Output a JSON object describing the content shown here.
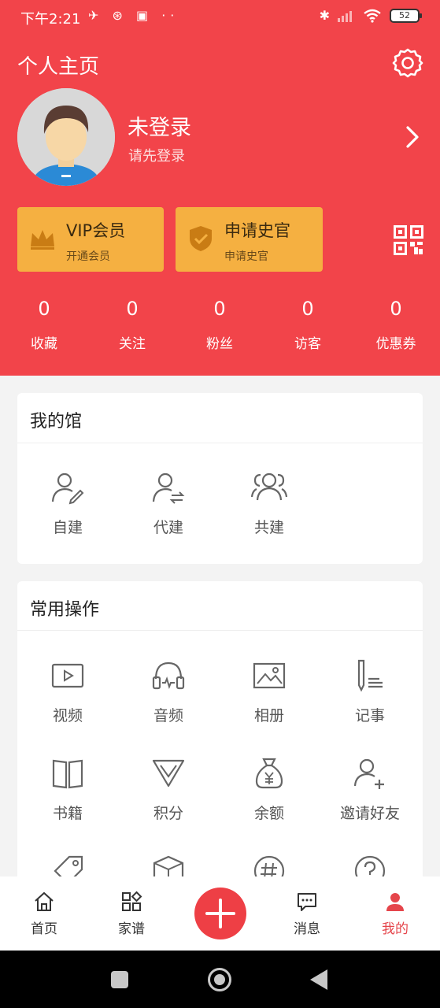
{
  "status_bar": {
    "time": "下午2:21",
    "left_icons": "✈ ⊛ ▣ ··",
    "battery": "52"
  },
  "header": {
    "title": "个人主页"
  },
  "profile": {
    "name": "未登录",
    "subtitle": "请先登录"
  },
  "cards": [
    {
      "title": "VIP会员",
      "subtitle": "开通会员"
    },
    {
      "title": "申请史官",
      "subtitle": "申请史官"
    }
  ],
  "stats": [
    {
      "value": "0",
      "label": "收藏"
    },
    {
      "value": "0",
      "label": "关注"
    },
    {
      "value": "0",
      "label": "粉丝"
    },
    {
      "value": "0",
      "label": "访客"
    },
    {
      "value": "0",
      "label": "优惠券"
    }
  ],
  "my_hall": {
    "title": "我的馆",
    "items": [
      {
        "label": "自建",
        "icon": "user-edit-icon"
      },
      {
        "label": "代建",
        "icon": "user-swap-icon"
      },
      {
        "label": "共建",
        "icon": "group-icon"
      }
    ]
  },
  "common_ops": {
    "title": "常用操作",
    "items": [
      {
        "label": "视频",
        "icon": "video-icon"
      },
      {
        "label": "音频",
        "icon": "headphones-icon"
      },
      {
        "label": "相册",
        "icon": "image-icon"
      },
      {
        "label": "记事",
        "icon": "notes-icon"
      },
      {
        "label": "书籍",
        "icon": "book-icon"
      },
      {
        "label": "积分",
        "icon": "diamond-icon"
      },
      {
        "label": "余额",
        "icon": "money-bag-icon"
      },
      {
        "label": "邀请好友",
        "icon": "add-user-icon"
      }
    ]
  },
  "bottom_nav": {
    "items": [
      {
        "label": "首页",
        "icon": "home-icon"
      },
      {
        "label": "家谱",
        "icon": "apps-icon"
      },
      {
        "label": "消息",
        "icon": "message-icon"
      },
      {
        "label": "我的",
        "icon": "profile-icon"
      }
    ]
  },
  "colors": {
    "primary": "#f2444a",
    "card": "#f5b041",
    "active_tab": "#e5454b"
  }
}
